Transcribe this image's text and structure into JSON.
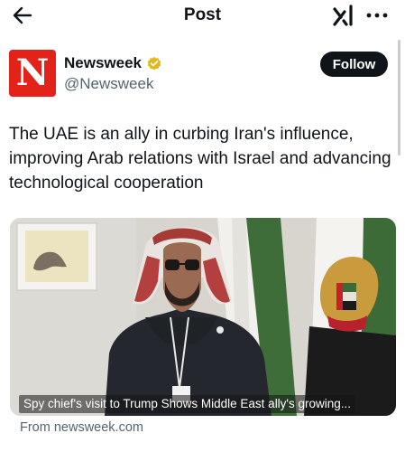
{
  "header": {
    "title": "Post",
    "back_icon": "arrow-left-icon",
    "grok_icon": "grok-icon",
    "more_icon": "more-horizontal-icon"
  },
  "author": {
    "name": "Newsweek",
    "handle": "@Newsweek",
    "avatar_letter": "N",
    "avatar_color": "#e32219",
    "verified_color": "#e2b71b",
    "verified_icon": "verified-badge-icon"
  },
  "follow_label": "Follow",
  "tweet": {
    "text": "The UAE is an ally in curbing Iran's influence, improving Arab relations with Israel and advancing technological cooperation"
  },
  "media": {
    "caption": "Spy chief's visit to Trump Shows Middle East ally's growing..."
  },
  "link_source": "From newsweek.com"
}
